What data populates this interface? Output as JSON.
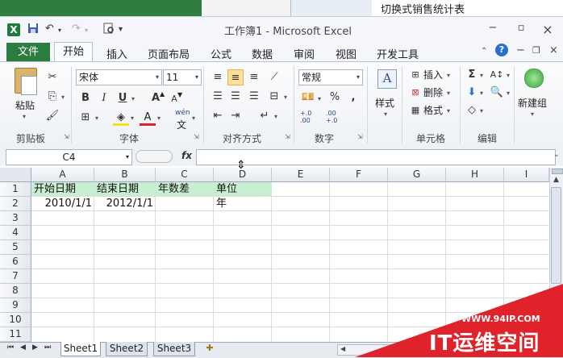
{
  "background": {
    "title": "切换式销售统计表"
  },
  "window": {
    "title": "工作簿1 - Microsoft Excel",
    "app_icon": "X",
    "qat": [
      "save-icon",
      "undo-icon",
      "redo-icon",
      "print-preview-icon"
    ],
    "controls": {
      "help_minimize": "△",
      "minimize": "−",
      "restore": "▫",
      "close": "×"
    }
  },
  "tabs": [
    "文件",
    "开始",
    "插入",
    "页面布局",
    "公式",
    "数据",
    "审阅",
    "视图",
    "开发工具"
  ],
  "ribbon": {
    "clipboard": {
      "paste": "粘贴",
      "label": "剪贴板"
    },
    "font": {
      "name": "宋体",
      "size": "11",
      "bold": "B",
      "italic": "I",
      "underline": "U",
      "grow": "A",
      "shrink": "A",
      "color": "A",
      "wen": "wén",
      "label": "字体"
    },
    "alignment": {
      "label": "对齐方式"
    },
    "number": {
      "format": "常规",
      "percent": "%",
      "comma": ",",
      "inc_decimal": "+.0 .00",
      "dec_decimal": ".00 +.0",
      "label": "数字"
    },
    "styles": {
      "label": "样式"
    },
    "cells": {
      "insert": "插入",
      "delete": "删除",
      "format": "格式",
      "label": "单元格"
    },
    "editing": {
      "sigma": "Σ",
      "label": "编辑"
    },
    "newbuild": {
      "label": "新建组"
    }
  },
  "formula_bar": {
    "name_box": "C4",
    "fx": "fx",
    "formula": ""
  },
  "columns": [
    "A",
    "B",
    "C",
    "D",
    "E",
    "F",
    "G",
    "H",
    "I"
  ],
  "rows": [
    "1",
    "2",
    "3",
    "4",
    "5",
    "6",
    "7",
    "8",
    "9",
    "10",
    "11"
  ],
  "cells": {
    "A1": "开始日期",
    "B1": "结束日期",
    "C1": "年数差",
    "D1": "单位",
    "A2": "2010/1/1",
    "B2": "2012/1/1",
    "D2": "年"
  },
  "sheets": [
    "Sheet1",
    "Sheet2",
    "Sheet3"
  ],
  "watermark": {
    "url": "WWW.94IP.COM",
    "brand": "IT运维空间"
  },
  "colors": {
    "excel_green": "#2b7d3f",
    "header_fill": "#c9efd2",
    "selected_align": "#fbe09a",
    "watermark_red": "#e0232b"
  }
}
